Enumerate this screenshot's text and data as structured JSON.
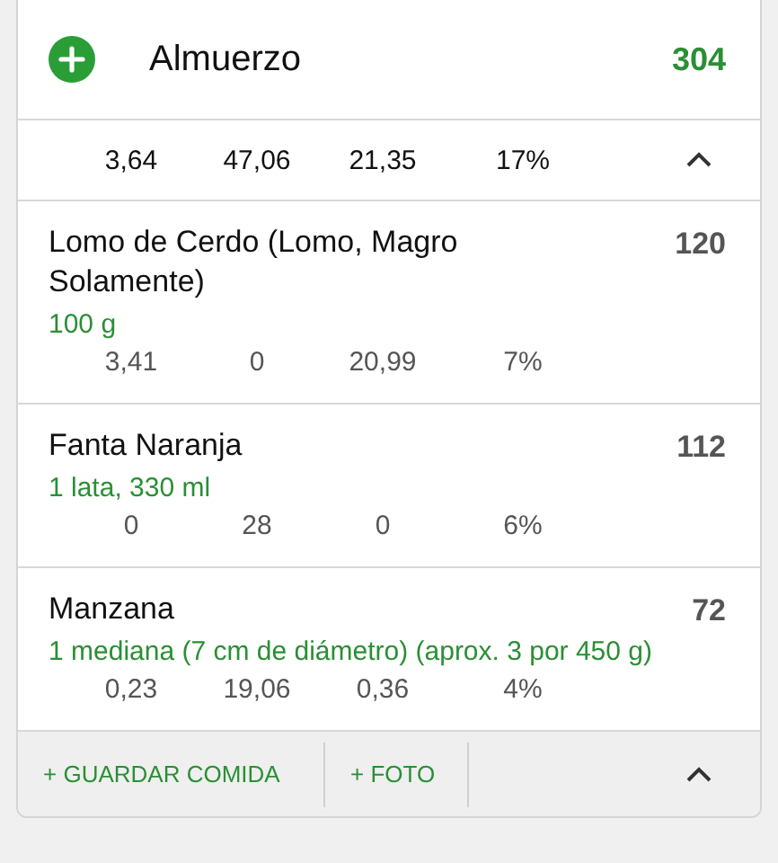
{
  "meal": {
    "title": "Almuerzo",
    "calories": "304"
  },
  "totals": [
    "3,64",
    "47,06",
    "21,35",
    "17%"
  ],
  "foods": [
    {
      "name": "Lomo de Cerdo (Lomo, Magro Solamente)",
      "calories": "120",
      "serving": "100 g",
      "nutrients": [
        "3,41",
        "0",
        "20,99",
        "7%"
      ]
    },
    {
      "name": "Fanta Naranja",
      "calories": "112",
      "serving": "1 lata, 330 ml",
      "nutrients": [
        "0",
        "28",
        "0",
        "6%"
      ]
    },
    {
      "name": "Manzana",
      "calories": "72",
      "serving": "1 mediana (7 cm de diámetro) (aprox. 3 por 450 g)",
      "nutrients": [
        "0,23",
        "19,06",
        "0,36",
        "4%"
      ]
    }
  ],
  "footer": {
    "buttons": [
      "+ GUARDAR COMIDA",
      "+ FOTO"
    ]
  }
}
